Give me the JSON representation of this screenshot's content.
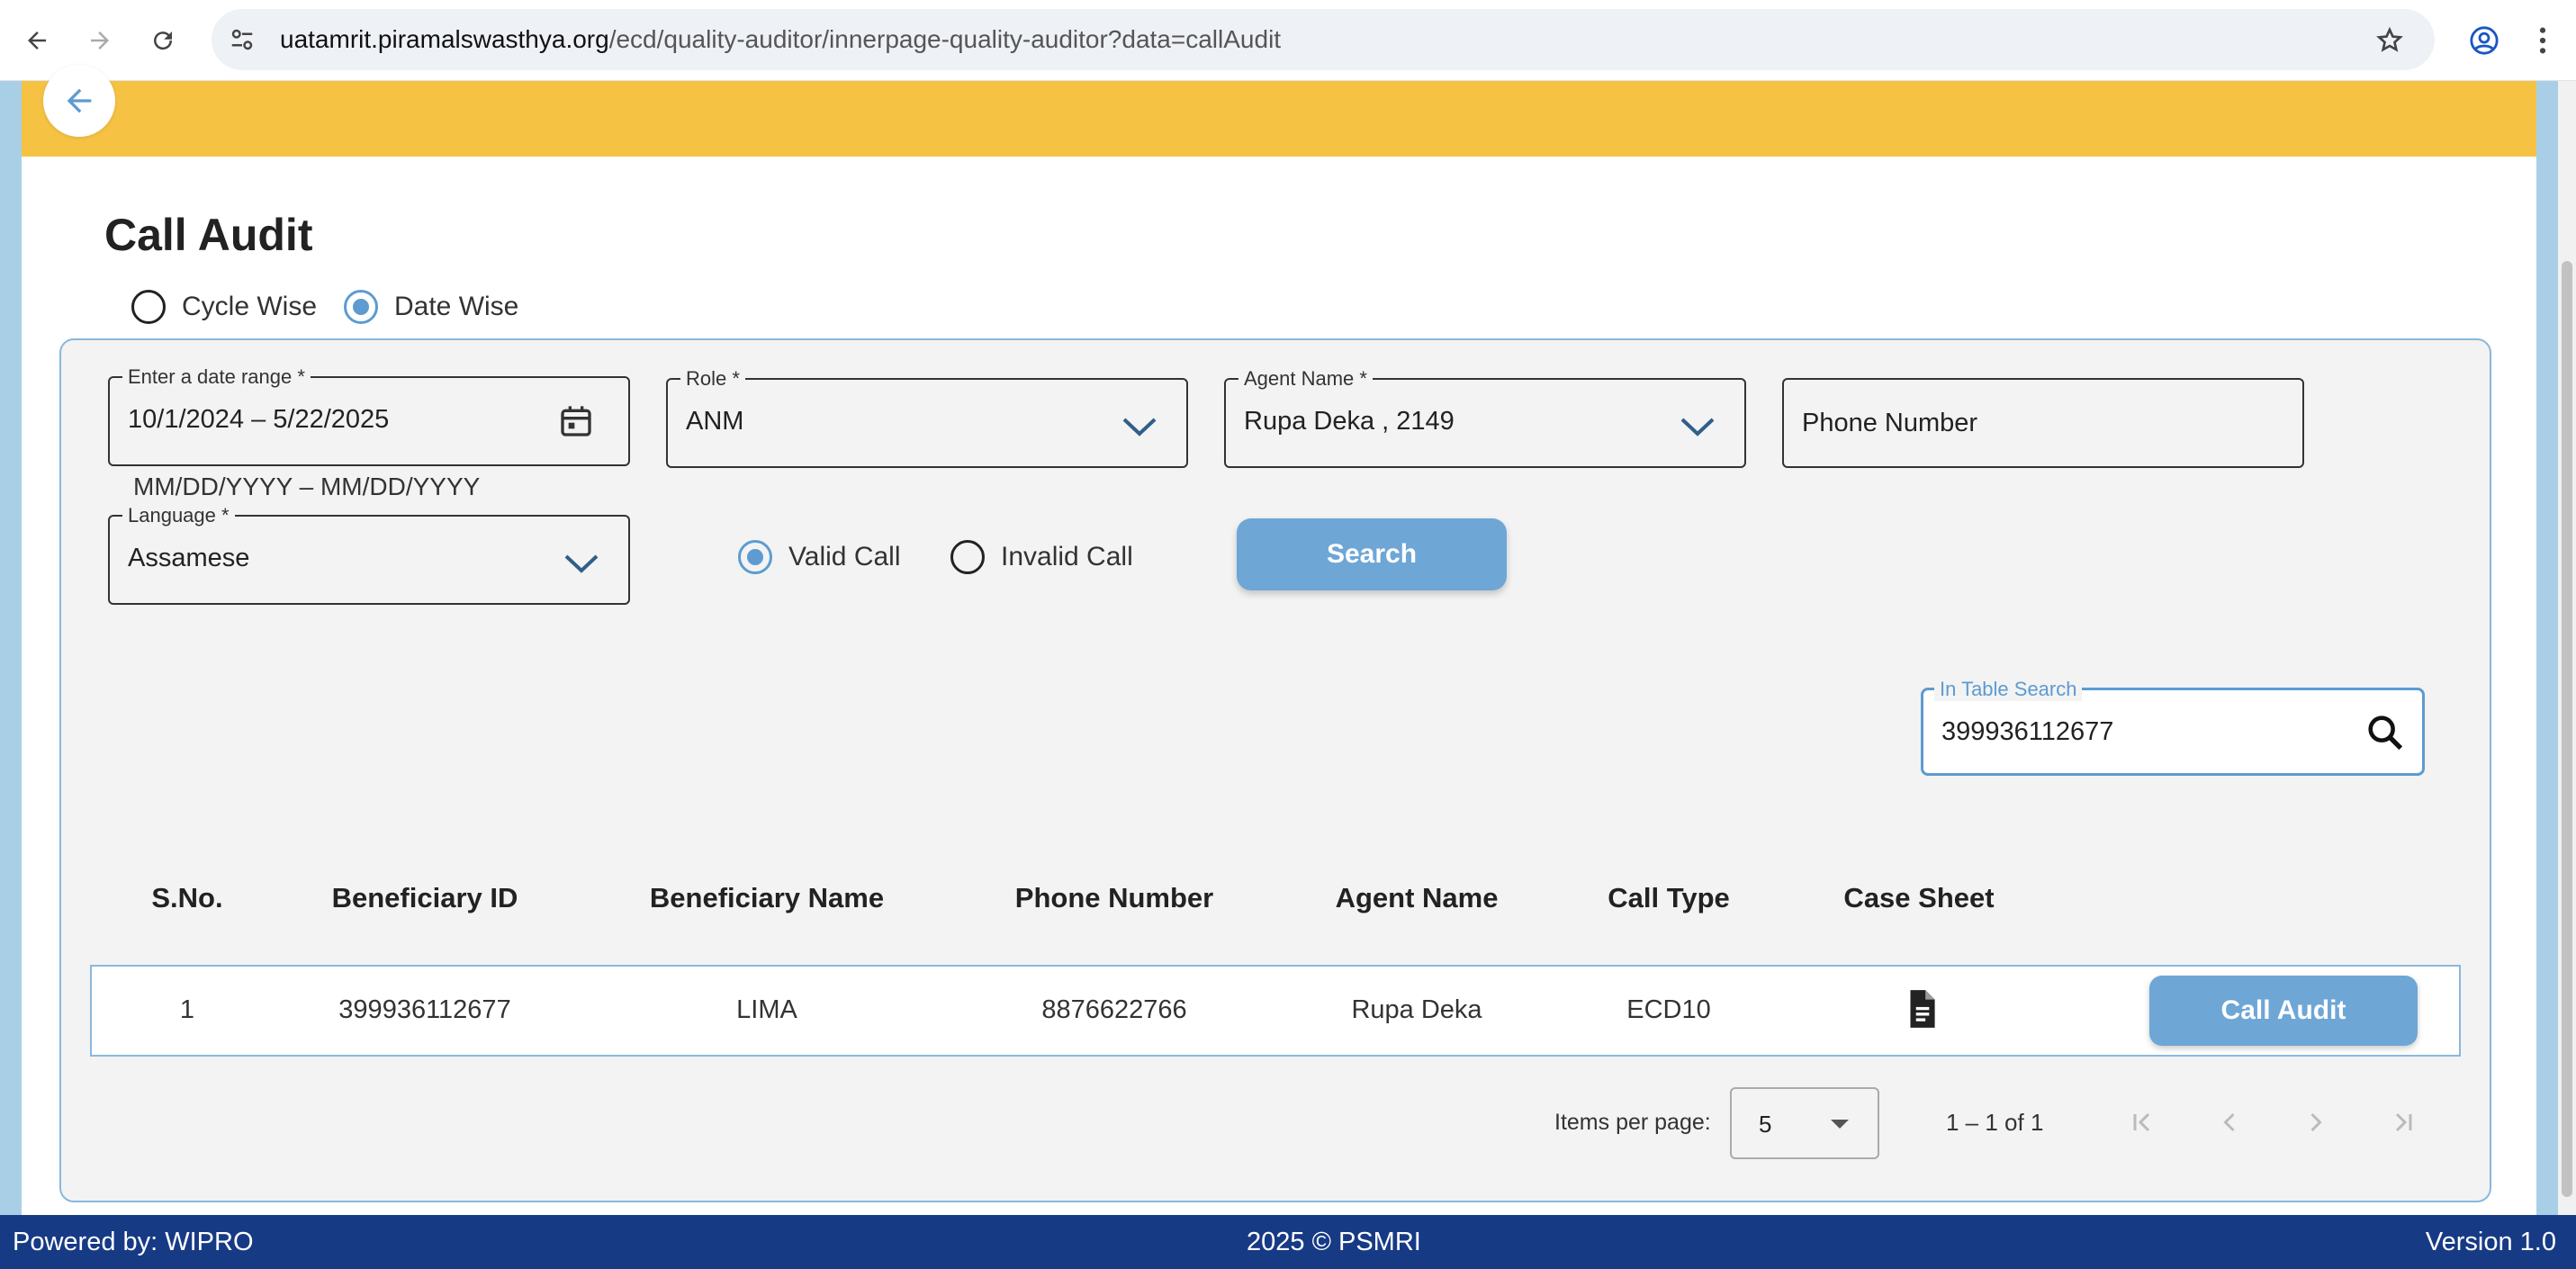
{
  "browser": {
    "url_host": "uatamrit.piramalswasthya.org",
    "url_path": "/ecd/quality-auditor/innerpage-quality-auditor?data=callAudit"
  },
  "page": {
    "title": "Call Audit",
    "mode_options": [
      "Cycle Wise",
      "Date Wise"
    ],
    "mode_selected": "Date Wise"
  },
  "filters": {
    "date_range": {
      "label": "Enter a date range *",
      "value": "10/1/2024 – 5/22/2025",
      "hint": "MM/DD/YYYY – MM/DD/YYYY"
    },
    "role": {
      "label": "Role *",
      "value": "ANM"
    },
    "agent": {
      "label": "Agent Name *",
      "value": "Rupa Deka , 2149"
    },
    "phone": {
      "placeholder": "Phone Number"
    },
    "language": {
      "label": "Language *",
      "value": "Assamese"
    },
    "call_validity_options": [
      "Valid Call",
      "Invalid Call"
    ],
    "call_validity_selected": "Valid Call",
    "search_label": "Search"
  },
  "table_search": {
    "label": "In Table Search",
    "value": "399936112677"
  },
  "table": {
    "headers": [
      "S.No.",
      "Beneficiary ID",
      "Beneficiary Name",
      "Phone Number",
      "Agent Name",
      "Call Type",
      "Case Sheet"
    ],
    "rows": [
      {
        "sno": "1",
        "beneficiary_id": "399936112677",
        "beneficiary_name": "LIMA",
        "phone": "8876622766",
        "agent": "Rupa Deka",
        "call_type": "ECD10",
        "action": "Call Audit"
      }
    ]
  },
  "pagination": {
    "items_per_page_label": "Items per page:",
    "items_per_page": "5",
    "range": "1 – 1 of 1"
  },
  "footer": {
    "left": "Powered by: WIPRO",
    "center": "2025 © PSMRI",
    "right": "Version 1.0"
  },
  "colors": {
    "banner": "#f5c244",
    "accent": "#5d9bd0",
    "button": "#6ea6d6",
    "footer": "#173a85"
  }
}
